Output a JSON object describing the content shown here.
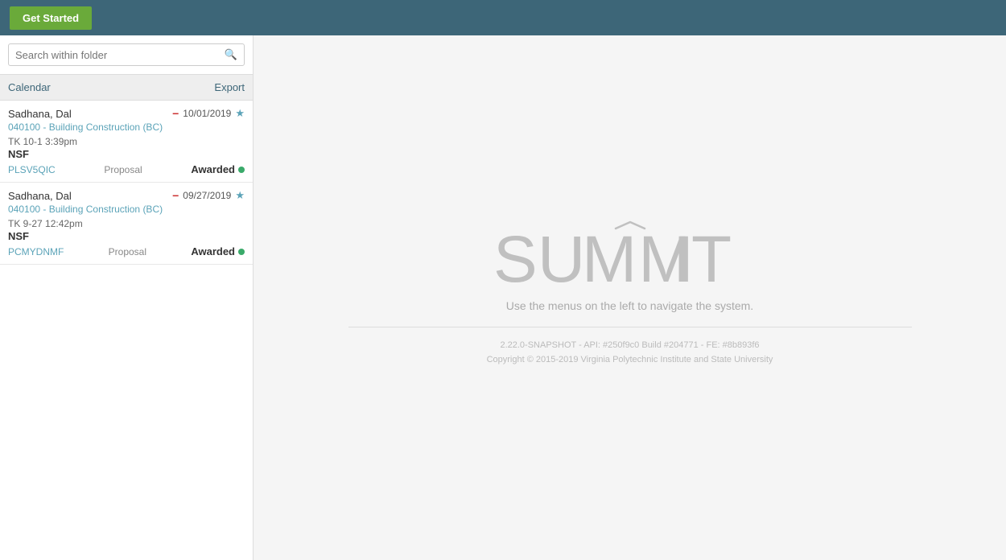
{
  "topNav": {
    "getStartedLabel": "Get Started"
  },
  "sidebar": {
    "searchPlaceholder": "Search within folder",
    "calendarLabel": "Calendar",
    "exportLabel": "Export",
    "items": [
      {
        "name": "Sadhana, Dal",
        "date": "10/01/2019",
        "dept": "040100 - Building Construction (BC)",
        "tk": "TK 10-1 3:39pm",
        "sponsor": "NSF",
        "code": "PLSV5QIC",
        "type": "Proposal",
        "status": "Awarded",
        "hasMinusIcon": true,
        "hasStar": true
      },
      {
        "name": "Sadhana, Dal",
        "date": "09/27/2019",
        "dept": "040100 - Building Construction (BC)",
        "tk": "TK 9-27 12:42pm",
        "sponsor": "NSF",
        "code": "PCMYDNMF",
        "type": "Proposal",
        "status": "Awarded",
        "hasMinusIcon": true,
        "hasStar": true
      }
    ]
  },
  "mainContent": {
    "logoText": "SUMMIT",
    "navMessage": "Use the menus on the left to navigate the system.",
    "versionLine1": "2.22.0-SNAPSHOT - API: #250f9c0  Build #204771 - FE: #8b893f6",
    "versionLine2": "Copyright © 2015-2019 Virginia Polytechnic Institute and State University"
  }
}
